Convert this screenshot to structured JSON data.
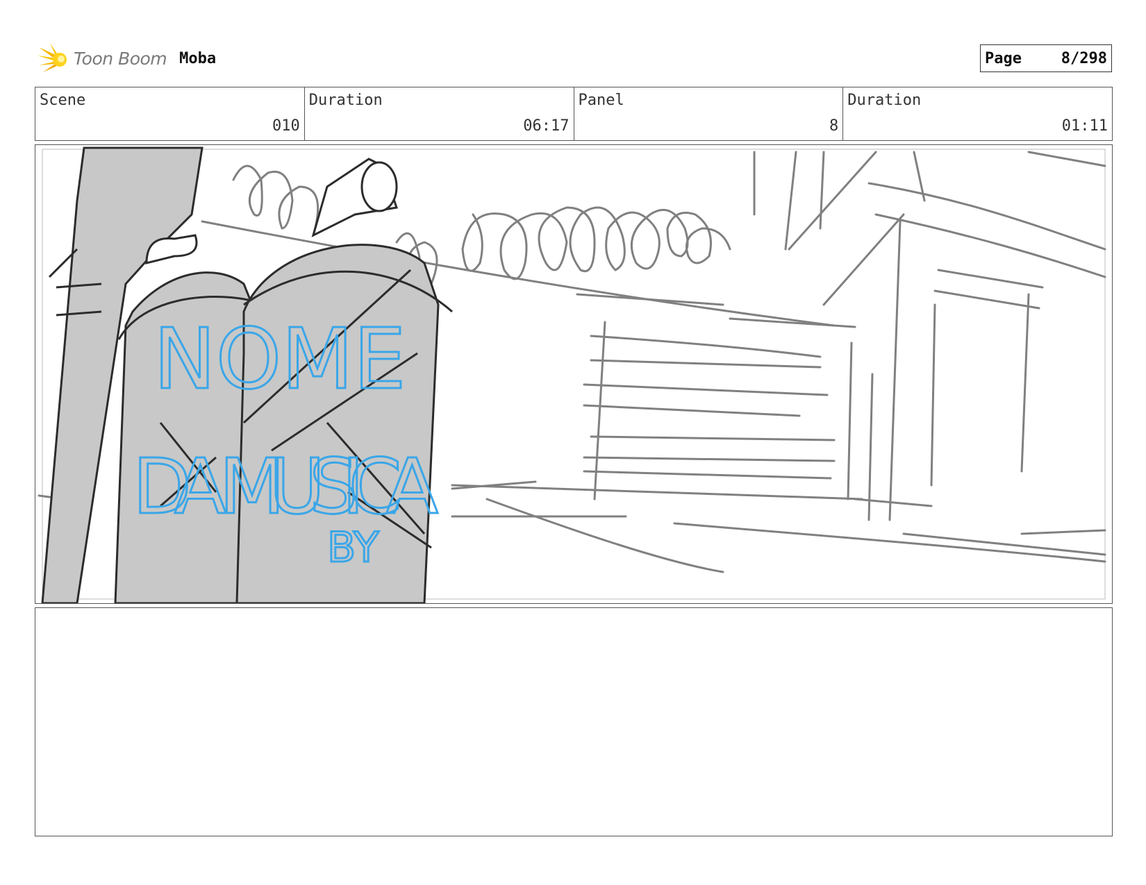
{
  "header": {
    "logo_text": "Toon Boom",
    "project_title": "Moba",
    "page_label": "Page",
    "page_value": "8/298"
  },
  "info": {
    "scene_label": "Scene",
    "scene_value": "010",
    "scene_duration_label": "Duration",
    "scene_duration_value": "06:17",
    "panel_label": "Panel",
    "panel_value": "8",
    "panel_duration_label": "Duration",
    "panel_duration_value": "01:11"
  },
  "sketch": {
    "graffiti_line1": "NOME",
    "graffiti_line2": "DA MUSICA",
    "graffiti_line3": "BY",
    "graffiti_color": "#3aa6e8",
    "fill_color": "#c8c8c8",
    "line_color": "#777777"
  },
  "notes": {
    "text": ""
  }
}
